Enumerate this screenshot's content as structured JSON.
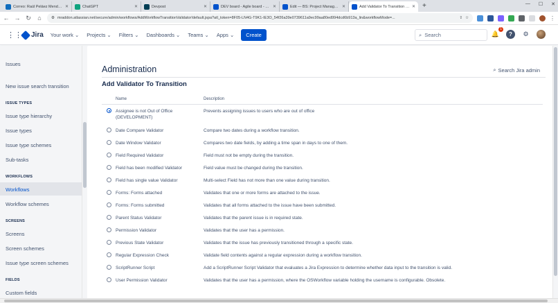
{
  "browser": {
    "tabs": [
      {
        "label": "Correo: Raúl Peláez Mendoza - C",
        "color": "#0f6cbd",
        "active": false
      },
      {
        "label": "ChatGPT",
        "color": "#10a37f",
        "active": false
      },
      {
        "label": "Devpost",
        "color": "#003e54",
        "active": false
      },
      {
        "label": "DEV board - Agile board - Team",
        "color": "#0052cc",
        "active": false
      },
      {
        "label": "Edit — BS: Project Management",
        "color": "#0052cc",
        "active": false
      },
      {
        "label": "Add Validator To Transition - Jira",
        "color": "#0052cc",
        "active": true
      }
    ],
    "new_tab": "+",
    "url": "mraddon.atlassian.net/secure/admin/workflows/AddWorkflowTransitionValidator!default.jspa?atl_token=8F05-LN4G-T9K1-IE3O_54f26a39e0739611a9ec99aa80ed994dcd6b913a_lin&workflowMode=..."
  },
  "header": {
    "logo": "Jira",
    "nav": [
      "Your work",
      "Projects",
      "Filters",
      "Dashboards",
      "Teams",
      "Apps"
    ],
    "create": "Create",
    "search_placeholder": "Search",
    "notification_count": "1"
  },
  "sidebar": {
    "issues": "Issues",
    "new_issue_search": "New issue search transition",
    "section_issue_types": "ISSUE TYPES",
    "issue_type_hierarchy": "Issue type hierarchy",
    "issue_types": "Issue types",
    "issue_type_schemes": "Issue type schemes",
    "sub_tasks": "Sub-tasks",
    "section_workflows": "WORKFLOWS",
    "workflows": "Workflows",
    "workflow_schemes": "Workflow schemes",
    "section_screens": "SCREENS",
    "screens": "Screens",
    "screen_schemes": "Screen schemes",
    "issue_type_screen_schemes": "Issue type screen schemes",
    "section_fields": "FIELDS",
    "custom_fields": "Custom fields"
  },
  "main": {
    "title": "Administration",
    "search_admin": "Search Jira admin",
    "subtitle": "Add Validator To Transition",
    "col_name": "Name",
    "col_description": "Description",
    "validators": [
      {
        "name": "Assignee is not Out of Office (DEVELOPMENT)",
        "desc": "Prevents assigning issues to users who are out of office",
        "checked": true
      },
      {
        "name": "Date Compare Validator",
        "desc": "Compare two dates during a workflow transition.",
        "checked": false
      },
      {
        "name": "Date Window Validator",
        "desc": "Compares two date fields, by adding a time span in days to one of them.",
        "checked": false
      },
      {
        "name": "Field Required Validator",
        "desc": "Field must not be empty during the transition.",
        "checked": false
      },
      {
        "name": "Field has been modified Validator",
        "desc": "Field value must be changed during the transition.",
        "checked": false
      },
      {
        "name": "Field has single value Validator",
        "desc": "Multi-select Field has not more than one value during transition.",
        "checked": false
      },
      {
        "name": "Forms: Forms attached",
        "desc": "Validates that one or more forms are attached to the issue.",
        "checked": false
      },
      {
        "name": "Forms: Forms submitted",
        "desc": "Validates that all forms attached to the issue have been submitted.",
        "checked": false
      },
      {
        "name": "Parent Status Validator",
        "desc": "Validates that the parent issue is in required state.",
        "checked": false
      },
      {
        "name": "Permission Validator",
        "desc": "Validates that the user has a permission.",
        "checked": false
      },
      {
        "name": "Previous State Validator",
        "desc": "Validates that the issue has previously transitioned through a specific state.",
        "checked": false
      },
      {
        "name": "Regular Expression Check",
        "desc": "Validate field contents against a regular expression during a workflow transition.",
        "checked": false
      },
      {
        "name": "ScriptRunner Script",
        "desc": "Add a ScriptRunner Script Validator that evaluates a Jira Expression to determine whether data input to the transition is valid.",
        "checked": false
      },
      {
        "name": "User Permission Validator",
        "desc": "Validates that the user has a permission, where the OSWorkflow variable holding the username is configurable. Obsolete.",
        "checked": false
      }
    ]
  }
}
